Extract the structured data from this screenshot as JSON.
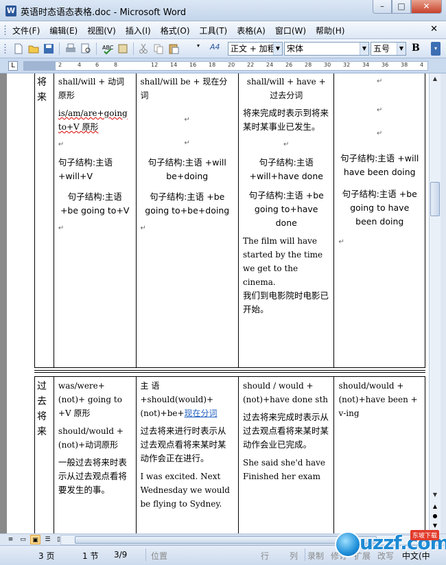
{
  "window": {
    "title": "英语时态语态表格.doc - Microsoft Word",
    "app_icon": "W",
    "min": "–",
    "max": "□",
    "close": "✕"
  },
  "menu": [
    "文件(F)",
    "编辑(E)",
    "视图(V)",
    "插入(I)",
    "格式(O)",
    "工具(T)",
    "表格(A)",
    "窗口(W)",
    "帮助(H)"
  ],
  "menu_close": "✕",
  "toolbar": {
    "style_value": "正文 + 加粗",
    "font_value": "宋体",
    "size_value": "五号",
    "bold_label": "B",
    "style_icon_label": "A4"
  },
  "ruler_ticks": [
    "2",
    "4",
    "6",
    "8",
    "12",
    "14",
    "16",
    "18",
    "20",
    "22",
    "24",
    "26",
    "28",
    "30",
    "32",
    "34",
    "36",
    "38",
    "4"
  ],
  "table": {
    "row1": {
      "tense": "将来",
      "c2": [
        "shall/will + 动词原形",
        "is/am/are+going to+V 原形",
        "句子结构:主语+will+V",
        "句子结构:主语 +be going to+V"
      ],
      "c3": [
        "shall/will be + 现在分词",
        "句子结构:主语 +will be+doing",
        "句子结构:主语 +be going to+be+doing"
      ],
      "c4": [
        "shall/will + have + 过去分词",
        "将来完成时表示到将来某时某事业已发生。",
        "句子结构:主语 +will+have done",
        "句子结构:主语 +be going to+have done",
        "The film will have started by the time we get to the cinema.",
        "我们到电影院时电影已开始。"
      ],
      "c5": [
        "句子结构:主语 +will have been doing",
        "句子结构:主语 +be going to have been doing"
      ]
    },
    "row2": {
      "tense": "过去将来",
      "c2": [
        "was/were+(not)+ going to +V 原形",
        "should/would + (not)+动词原形",
        "一般过去将来时表示从过去观点看将要发生的事。"
      ],
      "c3_prefix": "主 语 +should(would)+(not)+be+",
      "c3_link": "现在分词",
      "c3": [
        "过去将来进行时表示从过去观点看将来某时某动作会正在进行。",
        "I was excited. Next Wednesday we would be flying to Sydney."
      ],
      "c4": [
        "should / would +(not)+have done sth",
        "过去将来完成时表示从过去观点看将来某时某动作会业已完成。",
        "She said she'd have",
        "Finished her exam"
      ],
      "c5": [
        "should/would +(not)+have been + v-ing"
      ]
    }
  },
  "status": {
    "page": "3 页",
    "section": "1 节",
    "pages": "3/9",
    "position": "位置",
    "line": "行",
    "col": "列",
    "rec": "录制",
    "trk": "修订",
    "ext": "扩展",
    "ovr": "改写",
    "lang": "中文(中"
  },
  "watermark": {
    "brand": "uzzf.com",
    "tag": "东坡下载"
  }
}
